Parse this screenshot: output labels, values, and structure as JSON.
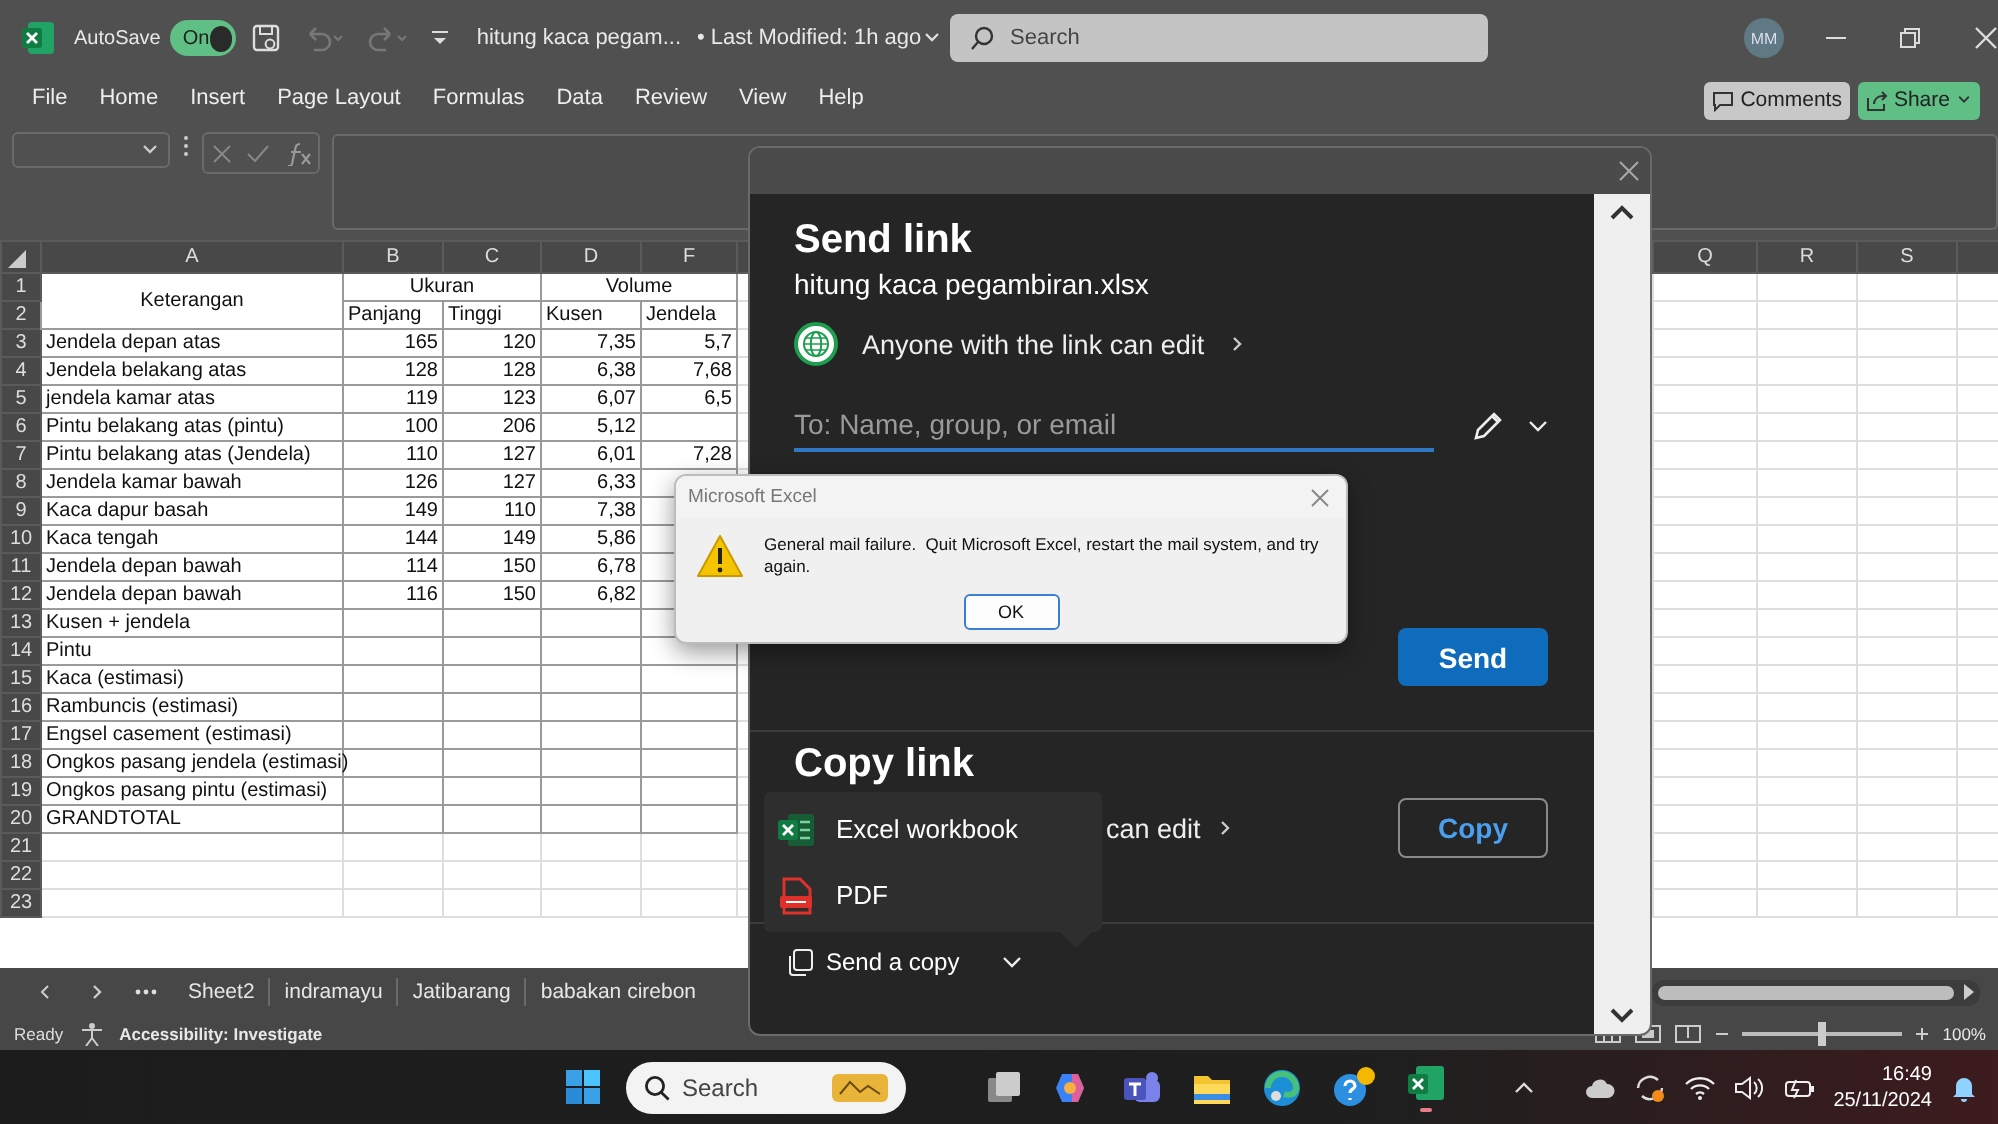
{
  "title_bar": {
    "autosave_label": "AutoSave",
    "autosave": {
      "label": "On",
      "on": true
    },
    "document_title": "hitung kaca pegam...",
    "last_modified": "• Last Modified: 1h ago",
    "search": {
      "placeholder": "Search"
    },
    "avatar": "MM"
  },
  "menu": {
    "items": [
      {
        "label": "File",
        "selected": false
      },
      {
        "label": "Home",
        "selected": false
      },
      {
        "label": "Insert",
        "selected": false
      },
      {
        "label": "Page Layout",
        "selected": false
      },
      {
        "label": "Formulas",
        "selected": false
      },
      {
        "label": "Data",
        "selected": false
      },
      {
        "label": "Review",
        "selected": false
      },
      {
        "label": "View",
        "selected": false
      },
      {
        "label": "Help",
        "selected": false
      }
    ],
    "comments_button": "Comments",
    "share_button": "Share"
  },
  "sheet": {
    "column_headers": [
      "A",
      "B",
      "C",
      "D",
      "F",
      "Q",
      "R",
      "S"
    ],
    "row_numbers": [
      "1",
      "2",
      "3",
      "4",
      "5",
      "6",
      "7",
      "8",
      "9",
      "10",
      "11",
      "12",
      "13",
      "14",
      "15",
      "16",
      "17",
      "18",
      "19",
      "20",
      "21",
      "22",
      "23"
    ],
    "header": {
      "label": "Keterangan",
      "group_1": "Ukuran",
      "group_2": "Volume",
      "subheaders": [
        "Panjang",
        "Tinggi",
        "Kusen",
        "Jendela"
      ]
    },
    "rows": [
      {
        "label": "Jendela depan atas",
        "values": [
          "165",
          "120",
          "7,35",
          "5,7"
        ]
      },
      {
        "label": "Jendela belakang atas",
        "values": [
          "128",
          "128",
          "6,38",
          "7,68"
        ]
      },
      {
        "label": "jendela kamar atas",
        "values": [
          "119",
          "123",
          "6,07",
          "6,5"
        ]
      },
      {
        "label": "Pintu belakang atas (pintu)",
        "values": [
          "100",
          "206",
          "5,12"
        ]
      },
      {
        "label": "Pintu belakang atas (Jendela)",
        "values": [
          "110",
          "127",
          "6,01",
          "7,28"
        ]
      },
      {
        "label": "Jendela kamar bawah",
        "values": [
          "126",
          "127",
          "6,33"
        ]
      },
      {
        "label": "Kaca dapur basah",
        "values": [
          "149",
          "110",
          "7,38"
        ]
      },
      {
        "label": "Kaca tengah",
        "values": [
          "144",
          "149",
          "5,86"
        ]
      },
      {
        "label": "Jendela depan bawah",
        "values": [
          "114",
          "150",
          "6,78"
        ]
      },
      {
        "label": "Jendela depan bawah",
        "values": [
          "116",
          "150",
          "6,82"
        ]
      },
      {
        "label": "Kusen + jendela",
        "values": []
      },
      {
        "label": "Pintu",
        "values": []
      },
      {
        "label": "Kaca (estimasi)",
        "values": []
      },
      {
        "label": "Rambuncis (estimasi)",
        "values": []
      },
      {
        "label": "Engsel  casement (estimasi)",
        "values": []
      },
      {
        "label": "Ongkos pasang jendela (estimasi)",
        "values": []
      },
      {
        "label": "Ongkos pasang pintu (estimasi)",
        "values": []
      },
      {
        "label": "GRANDTOTAL",
        "values": []
      }
    ]
  },
  "sheet_tabs": [
    {
      "label": "Sheet2",
      "selected": false
    },
    {
      "label": "indramayu",
      "selected": false
    },
    {
      "label": "Jatibarang",
      "selected": false
    },
    {
      "label": "babakan cirebon",
      "selected": false
    }
  ],
  "status_bar": {
    "ready": "Ready",
    "accessibility": "Accessibility: Investigate",
    "zoom_slider": {
      "level": 0.5
    },
    "zoom": "100%"
  },
  "share_dialog": {
    "title": "Send link",
    "filename": "hitung kaca pegambiran.xlsx",
    "permission": "Anyone with the link can edit",
    "recipient": {
      "placeholder": "To: Name, group, or email"
    },
    "send_button": "Send",
    "copy_title": "Copy link",
    "copy_permission": "can edit",
    "copy_button": "Copy",
    "send_copy": "Send a copy"
  },
  "copy_menu": [
    {
      "kind": "excel",
      "label": "Excel workbook"
    },
    {
      "kind": "pdf",
      "label": "PDF"
    }
  ],
  "error_dialog": {
    "title": "Microsoft Excel",
    "message": "General mail failure.  Quit Microsoft Excel, restart the mail system, and try again.",
    "button": "OK"
  },
  "taskbar": {
    "search": {
      "placeholder": "Search"
    },
    "time": "16:49",
    "date": "25/11/2024"
  }
}
